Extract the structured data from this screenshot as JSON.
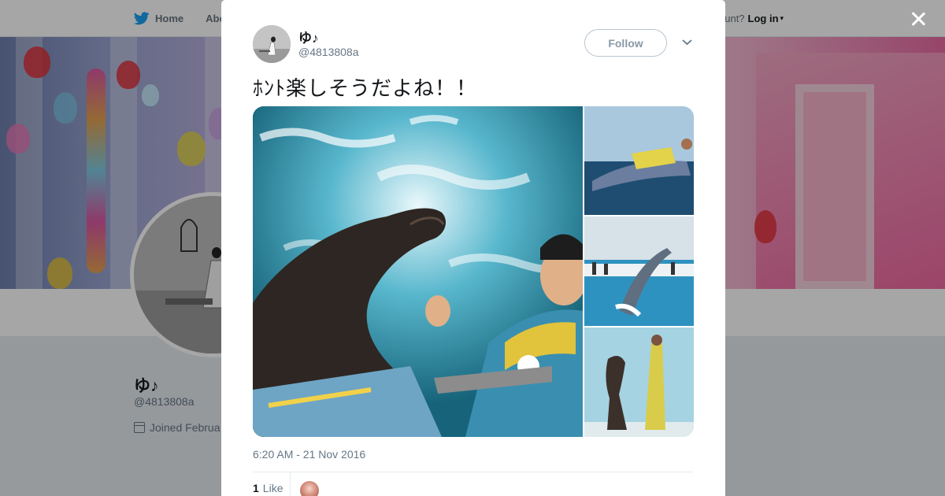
{
  "topbar": {
    "nav": [
      {
        "label": "Home",
        "icon": "twitter-bird-icon"
      },
      {
        "label": "Abo"
      }
    ],
    "login_prompt": "ccount?",
    "login_label": "Log in",
    "accent_color": "#1da1f2"
  },
  "profile": {
    "name": "ゆ♪",
    "handle": "@4813808a",
    "joined": "Joined Februa"
  },
  "tweet": {
    "author_name": "ゆ♪",
    "author_handle": "@4813808a",
    "follow_label": "Follow",
    "text": "ﾎﾝﾄ楽しそうだよね！！",
    "timestamp": "6:20 AM - 21 Nov 2016",
    "likes_count": "1",
    "likes_label": "Like",
    "photos": [
      "sea-lion-with-trainer",
      "dolphin-with-trainer",
      "dolphin-jumping",
      "sea-lion-standing-with-trainer"
    ]
  }
}
